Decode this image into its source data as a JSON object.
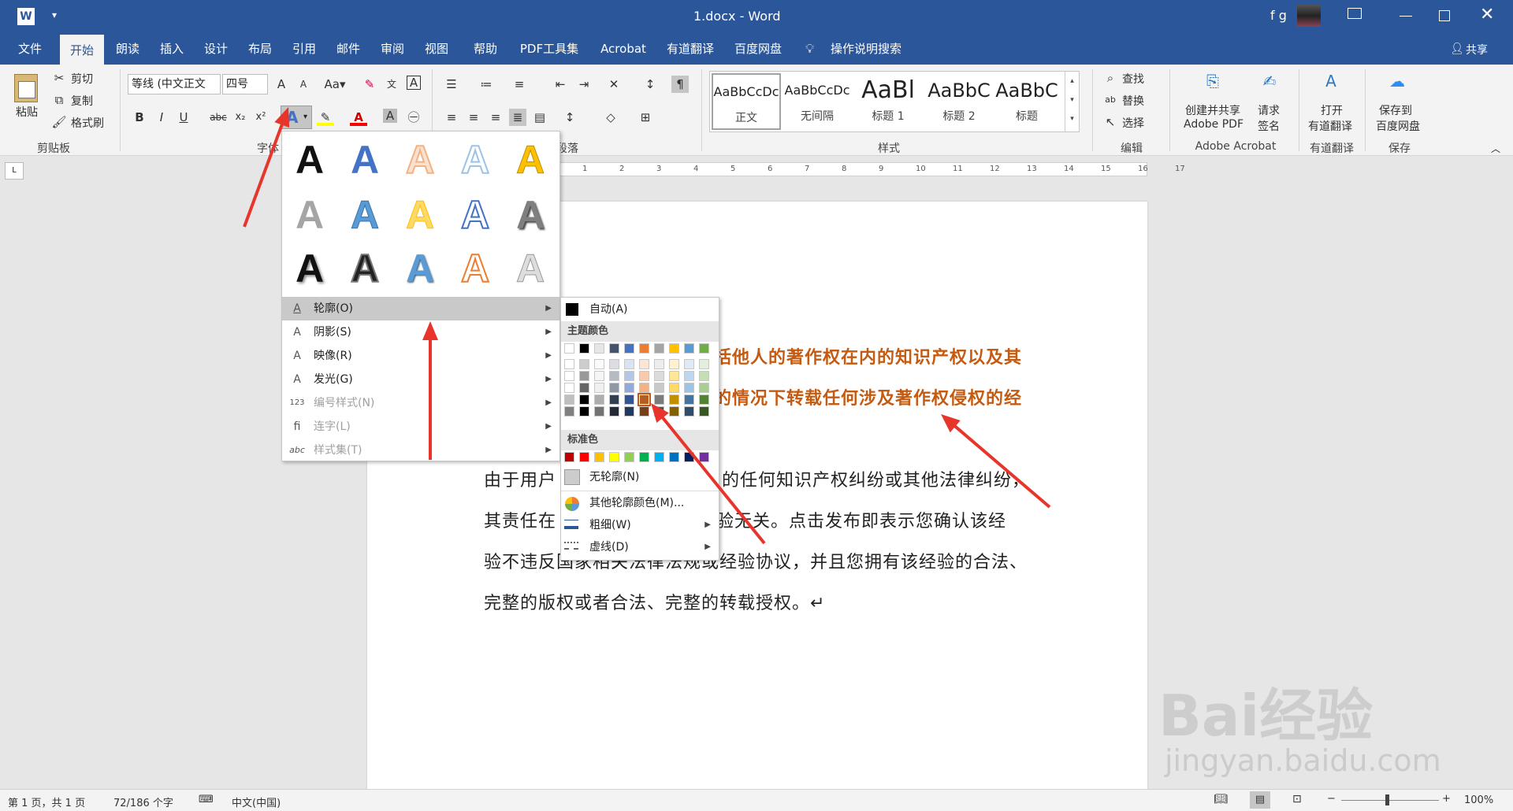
{
  "titlebar": {
    "doc_title": "1.docx - Word",
    "user": "f g",
    "logo": "W"
  },
  "tabs": [
    "文件",
    "开始",
    "朗读",
    "插入",
    "设计",
    "布局",
    "引用",
    "邮件",
    "审阅",
    "视图",
    "帮助",
    "PDF工具集",
    "Acrobat",
    "有道翻译",
    "百度网盘",
    "操作说明搜索"
  ],
  "share_label": "共享",
  "clipboard": {
    "paste": "粘贴",
    "cut": "剪切",
    "copy": "复制",
    "format_painter": "格式刷",
    "group": "剪贴板"
  },
  "font": {
    "name": "等线 (中文正文",
    "size": "四号",
    "group": "字体",
    "bold": "B",
    "italic": "I",
    "underline": "U",
    "strike": "abc",
    "sub": "x₂",
    "sup": "x²"
  },
  "paragraph": {
    "group": "段落"
  },
  "styles": {
    "group": "样式",
    "items": [
      {
        "preview": "AaBbCcDc",
        "name": "正文"
      },
      {
        "preview": "AaBbCcDc",
        "name": "无间隔"
      },
      {
        "preview": "AaBl",
        "name": "标题 1"
      },
      {
        "preview": "AaBbC",
        "name": "标题 2"
      },
      {
        "preview": "AaBbC",
        "name": "标题"
      }
    ]
  },
  "editing": {
    "find": "查找",
    "replace": "替换",
    "select": "选择",
    "group": "编辑"
  },
  "acrobat": {
    "create": "创建并共享",
    "create2": "Adobe PDF",
    "sign": "请求",
    "sign2": "签名",
    "group": "Adobe Acrobat"
  },
  "youdao": {
    "open": "打开",
    "open2": "有道翻译",
    "group": "有道翻译"
  },
  "baidu": {
    "save": "保存到",
    "save2": "百度网盘",
    "group": "保存"
  },
  "ruler_numbers": [
    "1",
    "2",
    "3",
    "4",
    "5",
    "6",
    "7",
    "8",
    "9",
    "10",
    "11",
    "12",
    "13",
    "14",
    "15",
    "16",
    "17"
  ],
  "document": {
    "line1": "括他人的著作权在内的知识产权以及其",
    "line2": "的情况下转载任何涉及著作权侵权的经",
    "line3a": "由于用户",
    "line3b": "的任何知识产权纠纷或其他法律纠纷，",
    "line4a": "其责任在",
    "line4b": "经验无关。点击发布即表示您确认该经",
    "line5": "验不违反国家相关法律法规或经验协议，并且您拥有该经验的合法、",
    "line6": "完整的版权或者合法、完整的转载授权。↵"
  },
  "effects_menu": {
    "items": [
      {
        "label": "轮廓(O)",
        "icon": "A"
      },
      {
        "label": "阴影(S)",
        "icon": "A"
      },
      {
        "label": "映像(R)",
        "icon": "A"
      },
      {
        "label": "发光(G)",
        "icon": "A"
      },
      {
        "label": "编号样式(N)",
        "icon": "123"
      },
      {
        "label": "连字(L)",
        "icon": "fi"
      },
      {
        "label": "样式集(T)",
        "icon": "abc"
      }
    ]
  },
  "outline_menu": {
    "auto": "自动(A)",
    "theme_header": "主题颜色",
    "standard_header": "标准色",
    "no_outline": "无轮廓(N)",
    "more_colors": "其他轮廓颜色(M)...",
    "weight": "粗细(W)",
    "dashes": "虚线(D)"
  },
  "colors": {
    "theme_top": [
      "#ffffff",
      "#000000",
      "#e7e6e6",
      "#44546a",
      "#4472c4",
      "#ed7d31",
      "#a5a5a5",
      "#ffc000",
      "#5b9bd5",
      "#70ad47"
    ],
    "standard": [
      "#c00000",
      "#ff0000",
      "#ffc000",
      "#ffff00",
      "#92d050",
      "#00b050",
      "#00b0f0",
      "#0070c0",
      "#002060",
      "#7030a0"
    ],
    "accent_highlight": "#c55a11",
    "annotation_arrow": "#e8352b"
  },
  "status": {
    "page": "第 1 页，共 1 页",
    "words": "72/186 个字",
    "lang": "中文(中国)",
    "zoom": "100%"
  },
  "watermark": {
    "brand": "Bai经验",
    "url": "jingyan.baidu.com"
  }
}
